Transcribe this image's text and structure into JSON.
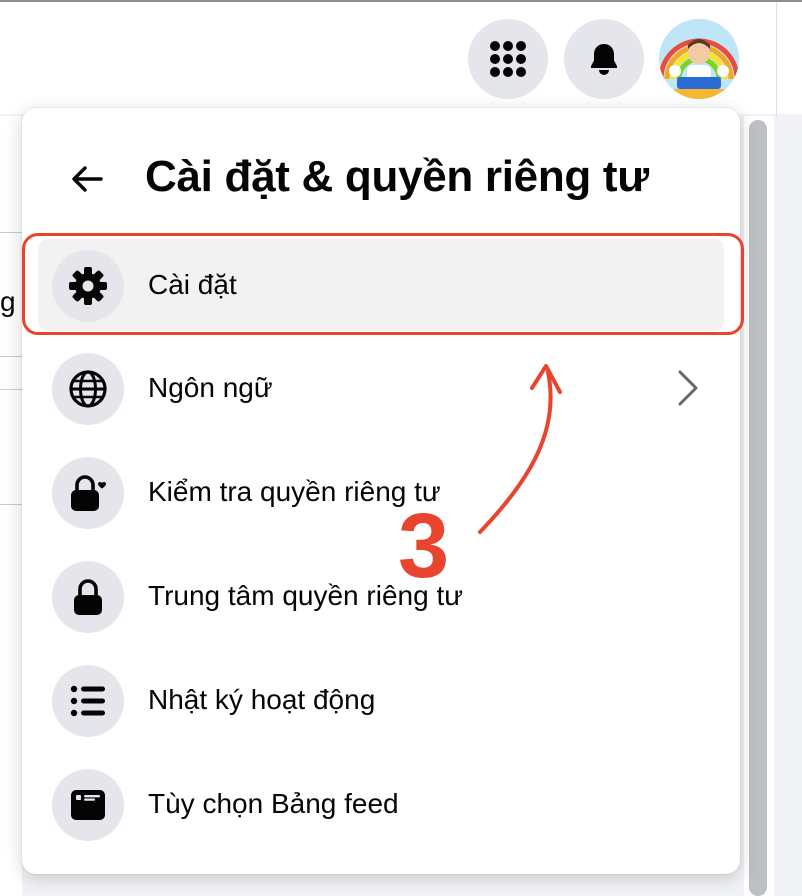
{
  "header": {
    "title": "Cài đặt & quyền riêng tư"
  },
  "topbar": {
    "menu_icon": "grid-dots-icon",
    "notifications_icon": "bell-icon"
  },
  "left_fragment": "g",
  "menu": {
    "items": [
      {
        "label": "Cài đặt",
        "icon": "gear-icon",
        "active": true
      },
      {
        "label": "Ngôn ngữ",
        "icon": "globe-icon",
        "has_submenu": true
      },
      {
        "label": "Kiểm tra quyền riêng tư",
        "icon": "lock-heart-icon"
      },
      {
        "label": "Trung tâm quyền riêng tư",
        "icon": "lock-icon"
      },
      {
        "label": "Nhật ký hoạt động",
        "icon": "list-icon"
      },
      {
        "label": "Tùy chọn Bảng feed",
        "icon": "feed-card-icon"
      }
    ]
  },
  "annotation": {
    "step": "3",
    "color": "#e8442e"
  }
}
